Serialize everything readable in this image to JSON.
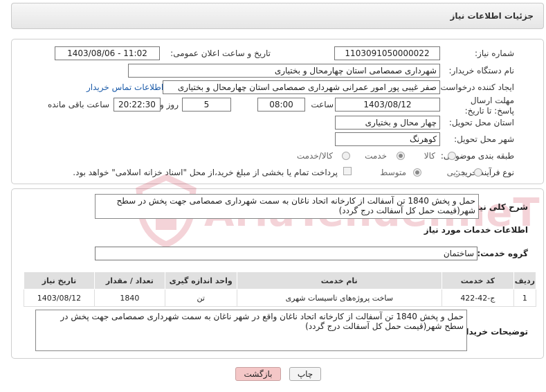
{
  "header": {
    "title": "جزئیات اطلاعات نیاز"
  },
  "form": {
    "need_number_label": "شماره نیاز:",
    "need_number": "1103091050000022",
    "announce_label": "تاریخ و ساعت اعلان عمومی:",
    "announce_value": "1403/08/06 - 11:02",
    "buyer_label": "نام دستگاه خریدار:",
    "buyer_value": "شهرداری صمصامی استان چهارمحال و بختیاری",
    "creator_label": "ایجاد کننده درخواست:",
    "creator_value": "صفر غیبی پور امور عمرانی شهرداری صمصامی استان چهارمحال و بختیاری",
    "contact_link": "اطلاعات تماس خریدار",
    "deadline_label": "مهلت ارسال پاسخ: تا تاریخ:",
    "deadline_date": "1403/08/12",
    "time_label": "ساعت",
    "deadline_time": "08:00",
    "days_value": "5",
    "days_label": "روز و",
    "remaining_time": "20:22:30",
    "remaining_label": "ساعت باقی مانده",
    "province_label": "استان محل تحویل:",
    "province_value": "چهار محال و بختیاری",
    "city_label": "شهر محل تحویل:",
    "city_value": "کوهرنگ",
    "category_label": "طبقه بندی موضوعی:",
    "category_options": [
      "کالا",
      "خدمت",
      "کالا/خدمت"
    ],
    "category_selected": 1,
    "process_label": "نوع فرآیند خرید :",
    "process_options": [
      "جزیی",
      "متوسط"
    ],
    "process_selected": 1,
    "payment_note": "پرداخت تمام یا بخشی از مبلغ خرید،از محل \"اسناد خزانه اسلامی\" خواهد بود."
  },
  "summary": {
    "label": "شرح کلی نیاز:",
    "text": "حمل و پخش 1840 تن  آسفالت از کارخانه اتحاد ناغان به سمت شهرداری صمصامی جهت پخش در سطح شهر(قیمت حمل کل آسفالت درج گردد)"
  },
  "services": {
    "section_title": "اطلاعات خدمات مورد نیاز",
    "group_label": "گروه خدمت:",
    "group_value": "ساختمان",
    "columns": [
      "ردیف",
      "کد خدمت",
      "نام خدمت",
      "واحد اندازه گیری",
      "تعداد / مقدار",
      "تاریخ نیاز"
    ],
    "rows": [
      [
        "1",
        "ج-42-422",
        "ساخت پروژه‌های تاسیسات شهری",
        "تن",
        "1840",
        "1403/08/12"
      ]
    ]
  },
  "buyer_notes": {
    "label": "توضیحات خریدار:",
    "text": "حمل و پخش 1840 تن  آسفالت از کارخانه اتحاد ناغان  واقع در شهر ناغان به سمت شهرداری صمصامی جهت پخش در سطح شهر(قیمت حمل کل آسفالت درج گردد)"
  },
  "buttons": {
    "print": "چاپ",
    "back": "بازگشت"
  },
  "watermark": "AriaTender.neT",
  "colors": {
    "back_button_bg": "#f4c7c7",
    "link": "#1a5aa8",
    "watermark": "#c8102e"
  }
}
